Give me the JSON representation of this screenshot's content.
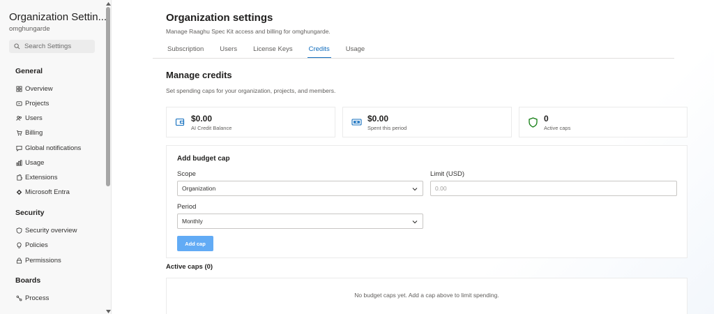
{
  "sidebar": {
    "title": "Organization Settin...",
    "subtitle": "omghungarde",
    "search_placeholder": "Search Settings",
    "groups": {
      "general": "General",
      "security": "Security",
      "boards": "Boards"
    },
    "items": [
      {
        "label": "Overview",
        "icon": "grid-icon"
      },
      {
        "label": "Projects",
        "icon": "projects-icon"
      },
      {
        "label": "Users",
        "icon": "users-icon"
      },
      {
        "label": "Billing",
        "icon": "cart-icon"
      },
      {
        "label": "Global notifications",
        "icon": "chat-icon"
      },
      {
        "label": "Usage",
        "icon": "usage-icon"
      },
      {
        "label": "Extensions",
        "icon": "extensions-icon"
      },
      {
        "label": "Microsoft Entra",
        "icon": "entra-icon"
      },
      {
        "label": "Security overview",
        "icon": "shield-icon"
      },
      {
        "label": "Policies",
        "icon": "bulb-icon"
      },
      {
        "label": "Permissions",
        "icon": "lock-icon"
      },
      {
        "label": "Process",
        "icon": "process-icon"
      }
    ]
  },
  "header": {
    "title": "Organization settings",
    "subtitle": "Manage Raaghu Spec Kit access and billing for omghungarde."
  },
  "tabs": [
    {
      "label": "Subscription"
    },
    {
      "label": "Users"
    },
    {
      "label": "License Keys"
    },
    {
      "label": "Credits",
      "active": true
    },
    {
      "label": "Usage"
    }
  ],
  "credits": {
    "title": "Manage credits",
    "subtitle": "Set spending caps for your organization, projects, and members.",
    "stats": [
      {
        "value": "$0.00",
        "label": "AI Credit Balance",
        "icon": "wallet-icon"
      },
      {
        "value": "$0.00",
        "label": "Spent this period",
        "icon": "money-icon"
      },
      {
        "value": "0",
        "label": "Active caps",
        "icon": "shield-icon"
      }
    ],
    "form": {
      "title": "Add budget cap",
      "scope_label": "Scope",
      "scope_value": "Organization",
      "limit_label": "Limit (USD)",
      "limit_placeholder": "0.00",
      "period_label": "Period",
      "period_value": "Monthly",
      "add_label": "Add cap"
    },
    "active_title": "Active caps (0)",
    "empty_text": "No budget caps yet. Add a cap above to limit spending."
  },
  "colors": {
    "accent": "#0f6cbd",
    "button": "#62abf5",
    "shield_green": "#107c10"
  }
}
